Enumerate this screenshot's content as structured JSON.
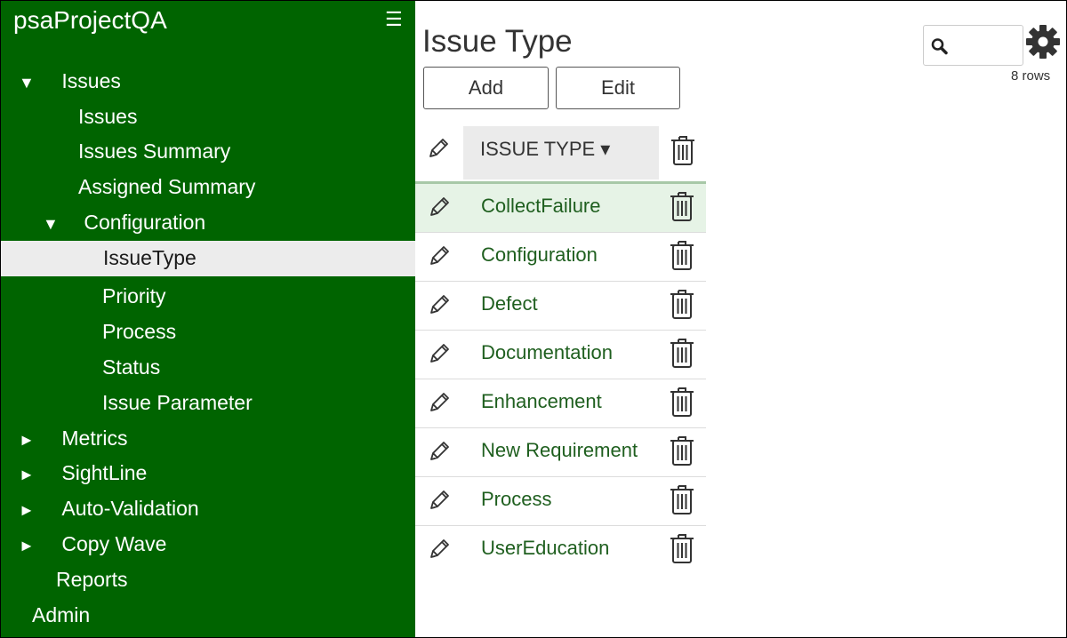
{
  "app": {
    "title": "psaProjectQA"
  },
  "sidebar": {
    "items": [
      {
        "label": "Issues",
        "arrow": "▼"
      },
      {
        "label": "Issues"
      },
      {
        "label": "Issues Summary"
      },
      {
        "label": "Assigned Summary"
      },
      {
        "label": "Configuration",
        "arrow": "▼"
      },
      {
        "label": "IssueType",
        "selected": true
      },
      {
        "label": "Priority"
      },
      {
        "label": "Process"
      },
      {
        "label": "Status"
      },
      {
        "label": "Issue Parameter"
      },
      {
        "label": "Metrics",
        "arrow": "►"
      },
      {
        "label": "SightLine",
        "arrow": "►"
      },
      {
        "label": "Auto-Validation",
        "arrow": "►"
      },
      {
        "label": "Copy Wave",
        "arrow": "►"
      },
      {
        "label": "Reports"
      },
      {
        "label": "Admin"
      }
    ]
  },
  "main": {
    "title": "Issue Type",
    "add_label": "Add",
    "edit_label": "Edit",
    "row_count": "8 rows",
    "table": {
      "column_header": "ISSUE TYPE ▾",
      "rows": [
        "CollectFailure",
        "Configuration",
        "Defect",
        "Documentation",
        "Enhancement",
        "New Requirement",
        "Process",
        "UserEducation"
      ]
    }
  },
  "colors": {
    "sidebar_bg": "#006400",
    "row_highlight": "#e6f3e6",
    "link_text": "#1f5f1f"
  },
  "icons": [
    "hamburger-menu-icon",
    "search-icon",
    "gear-icon",
    "pencil-icon",
    "trash-icon"
  ]
}
